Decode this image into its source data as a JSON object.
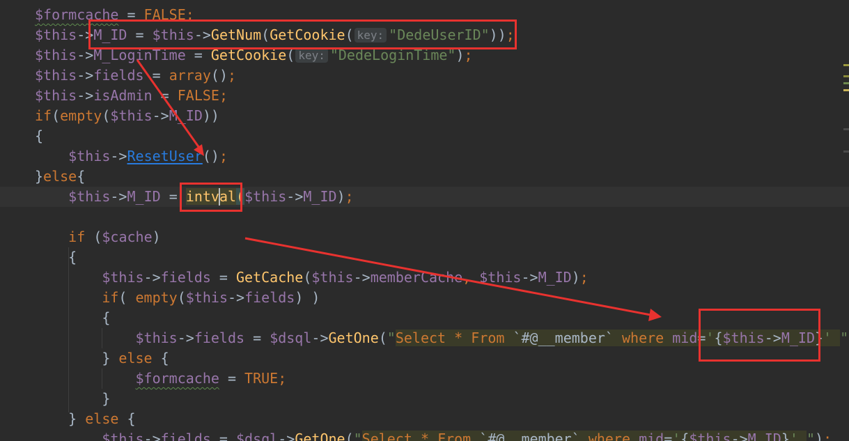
{
  "colors": {
    "background": "#2B2B2B",
    "current_line": "#323232",
    "text": "#A9B7C6",
    "keyword": "#CC7832",
    "variable": "#9876AA",
    "function": "#FFC66D",
    "string": "#6A8759",
    "link": "#287BDE",
    "hint_bg": "#3B3F41",
    "hint_text": "#7D8187",
    "sql_bg": "#3A3B28",
    "annotation": "#E8322F"
  },
  "lines": [
    {
      "tokens": [
        {
          "k": "var-typo",
          "t": "$formcache"
        },
        {
          "k": "def",
          "t": " = "
        },
        {
          "k": "kw",
          "t": "FALSE"
        },
        {
          "k": "semi",
          "t": ";"
        }
      ]
    },
    {
      "tokens": [
        {
          "k": "var",
          "t": "$this"
        },
        {
          "k": "def",
          "t": "->"
        },
        {
          "k": "field",
          "t": "M_ID"
        },
        {
          "k": "def",
          "t": " = "
        },
        {
          "k": "var",
          "t": "$this"
        },
        {
          "k": "def",
          "t": "->"
        },
        {
          "k": "fn",
          "t": "GetNum"
        },
        {
          "k": "def",
          "t": "("
        },
        {
          "k": "fn",
          "t": "GetCookie"
        },
        {
          "k": "def",
          "t": "("
        },
        {
          "k": "hint",
          "t": "key:"
        },
        {
          "k": "str",
          "t": "\"DedeUserID\""
        },
        {
          "k": "def",
          "t": "))"
        },
        {
          "k": "semi",
          "t": ";"
        }
      ]
    },
    {
      "tokens": [
        {
          "k": "var",
          "t": "$this"
        },
        {
          "k": "def",
          "t": "->"
        },
        {
          "k": "field",
          "t": "M_LoginTime"
        },
        {
          "k": "def",
          "t": " = "
        },
        {
          "k": "fn",
          "t": "GetCookie"
        },
        {
          "k": "def",
          "t": "("
        },
        {
          "k": "hint",
          "t": "key:"
        },
        {
          "k": "str",
          "t": "\"DedeLoginTime\""
        },
        {
          "k": "def",
          "t": ")"
        },
        {
          "k": "semi",
          "t": ";"
        }
      ]
    },
    {
      "tokens": [
        {
          "k": "var",
          "t": "$this"
        },
        {
          "k": "def",
          "t": "->"
        },
        {
          "k": "field",
          "t": "fields"
        },
        {
          "k": "def",
          "t": " = "
        },
        {
          "k": "kw",
          "t": "array"
        },
        {
          "k": "def",
          "t": "()"
        },
        {
          "k": "semi",
          "t": ";"
        }
      ]
    },
    {
      "tokens": [
        {
          "k": "var",
          "t": "$this"
        },
        {
          "k": "def",
          "t": "->"
        },
        {
          "k": "field",
          "t": "isAdmin"
        },
        {
          "k": "def",
          "t": " = "
        },
        {
          "k": "kw",
          "t": "FALSE"
        },
        {
          "k": "semi",
          "t": ";"
        }
      ]
    },
    {
      "tokens": [
        {
          "k": "kw",
          "t": "if"
        },
        {
          "k": "def",
          "t": "("
        },
        {
          "k": "kw",
          "t": "empty"
        },
        {
          "k": "def",
          "t": "("
        },
        {
          "k": "var",
          "t": "$this"
        },
        {
          "k": "def",
          "t": "->"
        },
        {
          "k": "field",
          "t": "M_ID"
        },
        {
          "k": "def",
          "t": "))"
        }
      ]
    },
    {
      "tokens": [
        {
          "k": "def",
          "t": "{"
        }
      ]
    },
    {
      "tokens": [
        {
          "k": "ws",
          "t": "    "
        },
        {
          "k": "var",
          "t": "$this"
        },
        {
          "k": "def",
          "t": "->"
        },
        {
          "k": "link",
          "t": "ResetUser"
        },
        {
          "k": "def",
          "t": "()"
        },
        {
          "k": "semi",
          "t": ";"
        }
      ]
    },
    {
      "tokens": [
        {
          "k": "def",
          "t": "}"
        },
        {
          "k": "kw",
          "t": "else"
        },
        {
          "k": "def",
          "t": "{"
        }
      ]
    },
    {
      "current": true,
      "tokens": [
        {
          "k": "ws",
          "t": "    "
        },
        {
          "k": "var",
          "t": "$this"
        },
        {
          "k": "def",
          "t": "->"
        },
        {
          "k": "field",
          "t": "M_ID"
        },
        {
          "k": "def",
          "t": " = "
        },
        {
          "k": "fnhl",
          "t": "intval"
        },
        {
          "k": "parenhl",
          "t": "("
        },
        {
          "k": "var",
          "t": "$this"
        },
        {
          "k": "def",
          "t": "->"
        },
        {
          "k": "field",
          "t": "M_ID"
        },
        {
          "k": "def",
          "t": ")"
        },
        {
          "k": "semi",
          "t": ";"
        }
      ]
    },
    {
      "tokens": []
    },
    {
      "tokens": [
        {
          "k": "ws",
          "t": "    "
        },
        {
          "k": "kw",
          "t": "if"
        },
        {
          "k": "def",
          "t": " ("
        },
        {
          "k": "var",
          "t": "$cache"
        },
        {
          "k": "def",
          "t": ")"
        }
      ]
    },
    {
      "tokens": [
        {
          "k": "ws",
          "t": "    "
        },
        {
          "k": "def",
          "t": "{"
        }
      ]
    },
    {
      "tokens": [
        {
          "k": "ws",
          "t": "        "
        },
        {
          "k": "var",
          "t": "$this"
        },
        {
          "k": "def",
          "t": "->"
        },
        {
          "k": "field",
          "t": "fields"
        },
        {
          "k": "def",
          "t": " = "
        },
        {
          "k": "fn",
          "t": "GetCache"
        },
        {
          "k": "def",
          "t": "("
        },
        {
          "k": "var",
          "t": "$this"
        },
        {
          "k": "def",
          "t": "->"
        },
        {
          "k": "field",
          "t": "memberCache"
        },
        {
          "k": "comma",
          "t": ", "
        },
        {
          "k": "var",
          "t": "$this"
        },
        {
          "k": "def",
          "t": "->"
        },
        {
          "k": "field",
          "t": "M_ID"
        },
        {
          "k": "def",
          "t": ")"
        },
        {
          "k": "semi",
          "t": ";"
        }
      ]
    },
    {
      "tokens": [
        {
          "k": "ws",
          "t": "        "
        },
        {
          "k": "kw",
          "t": "if"
        },
        {
          "k": "def",
          "t": "( "
        },
        {
          "k": "kw",
          "t": "empty"
        },
        {
          "k": "def",
          "t": "("
        },
        {
          "k": "var",
          "t": "$this"
        },
        {
          "k": "def",
          "t": "->"
        },
        {
          "k": "field",
          "t": "fields"
        },
        {
          "k": "def",
          "t": ") )"
        }
      ]
    },
    {
      "tokens": [
        {
          "k": "ws",
          "t": "        "
        },
        {
          "k": "def",
          "t": "{"
        }
      ]
    },
    {
      "tokens": [
        {
          "k": "ws",
          "t": "            "
        },
        {
          "k": "var",
          "t": "$this"
        },
        {
          "k": "def",
          "t": "->"
        },
        {
          "k": "field",
          "t": "fields"
        },
        {
          "k": "def",
          "t": " = "
        },
        {
          "k": "var",
          "t": "$dsql"
        },
        {
          "k": "def",
          "t": "->"
        },
        {
          "k": "fn",
          "t": "GetOne"
        },
        {
          "k": "def",
          "t": "("
        },
        {
          "k": "str",
          "t": "\""
        },
        {
          "k": "sqlkw",
          "t": "Select"
        },
        {
          "k": "sql",
          "t": " "
        },
        {
          "k": "sqlkw",
          "t": "*"
        },
        {
          "k": "sql",
          "t": " "
        },
        {
          "k": "sqlkw",
          "t": "From"
        },
        {
          "k": "sql",
          "t": " `#@__member` "
        },
        {
          "k": "sqlkw",
          "t": "where"
        },
        {
          "k": "sql",
          "t": " "
        },
        {
          "k": "sqlcol",
          "t": "mid"
        },
        {
          "k": "sql",
          "t": "="
        },
        {
          "k": "sqlstr",
          "t": "'"
        },
        {
          "k": "sql",
          "t": "{"
        },
        {
          "k": "sqlvar",
          "t": "$this"
        },
        {
          "k": "sql",
          "t": "->"
        },
        {
          "k": "sqlvar",
          "t": "M_ID"
        },
        {
          "k": "sql",
          "t": "}"
        },
        {
          "k": "sqlstr",
          "t": "'"
        },
        {
          "k": "sql",
          "t": " "
        },
        {
          "k": "str",
          "t": "\""
        },
        {
          "k": "def",
          "t": ")"
        },
        {
          "k": "semi",
          "t": ";"
        }
      ]
    },
    {
      "tokens": [
        {
          "k": "ws",
          "t": "        "
        },
        {
          "k": "def",
          "t": "} "
        },
        {
          "k": "kw",
          "t": "else"
        },
        {
          "k": "def",
          "t": " {"
        }
      ]
    },
    {
      "tokens": [
        {
          "k": "ws",
          "t": "            "
        },
        {
          "k": "var-typo",
          "t": "$formcache"
        },
        {
          "k": "def",
          "t": " = "
        },
        {
          "k": "kw",
          "t": "TRUE"
        },
        {
          "k": "semi",
          "t": ";"
        }
      ]
    },
    {
      "tokens": [
        {
          "k": "ws",
          "t": "        "
        },
        {
          "k": "def",
          "t": "}"
        }
      ]
    },
    {
      "tokens": [
        {
          "k": "ws",
          "t": "    "
        },
        {
          "k": "def",
          "t": "} "
        },
        {
          "k": "kw",
          "t": "else"
        },
        {
          "k": "def",
          "t": " {"
        }
      ]
    },
    {
      "tokens": [
        {
          "k": "ws",
          "t": "        "
        },
        {
          "k": "var",
          "t": "$this"
        },
        {
          "k": "def",
          "t": "->"
        },
        {
          "k": "field",
          "t": "fields"
        },
        {
          "k": "def",
          "t": " = "
        },
        {
          "k": "var",
          "t": "$dsql"
        },
        {
          "k": "def",
          "t": "->"
        },
        {
          "k": "fn",
          "t": "GetOne"
        },
        {
          "k": "def",
          "t": "("
        },
        {
          "k": "str",
          "t": "\""
        },
        {
          "k": "sqlkw",
          "t": "Select"
        },
        {
          "k": "sql",
          "t": " "
        },
        {
          "k": "sqlkw",
          "t": "*"
        },
        {
          "k": "sql",
          "t": " "
        },
        {
          "k": "sqlkw",
          "t": "From"
        },
        {
          "k": "sql",
          "t": " `#@__member` "
        },
        {
          "k": "sqlkw",
          "t": "where"
        },
        {
          "k": "sql",
          "t": " "
        },
        {
          "k": "sqlcol",
          "t": "mid"
        },
        {
          "k": "sql",
          "t": "="
        },
        {
          "k": "sqlstr",
          "t": "'"
        },
        {
          "k": "sql",
          "t": "{"
        },
        {
          "k": "sqlvar",
          "t": "$this"
        },
        {
          "k": "sql",
          "t": "->"
        },
        {
          "k": "sqlvar",
          "t": "M_ID"
        },
        {
          "k": "sql",
          "t": "}"
        },
        {
          "k": "sqlstr",
          "t": "'"
        },
        {
          "k": "sql",
          "t": " "
        },
        {
          "k": "str",
          "t": "\""
        },
        {
          "k": "def",
          "t": ")"
        },
        {
          "k": "semi",
          "t": ";"
        }
      ]
    }
  ]
}
